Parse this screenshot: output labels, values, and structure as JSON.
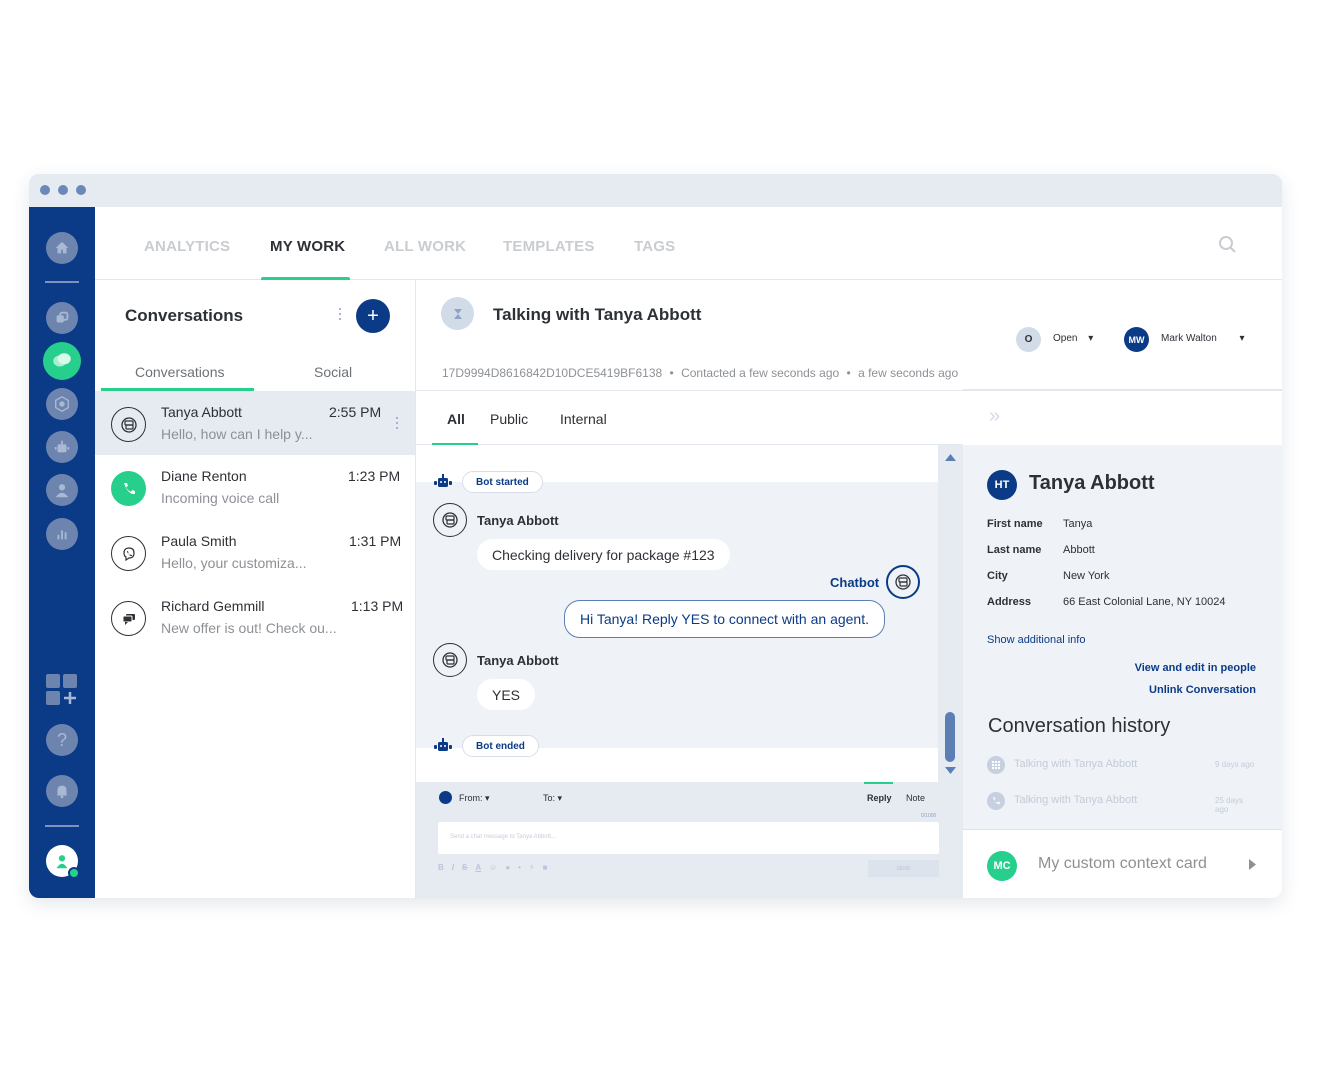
{
  "window": {
    "controls": [
      "dot",
      "dot",
      "dot"
    ]
  },
  "sidebar": {
    "items": [
      {
        "icon": "home-icon"
      },
      {
        "icon": "integrations-icon"
      },
      {
        "icon": "conversations-icon",
        "active": true
      },
      {
        "icon": "network-icon"
      },
      {
        "icon": "bot-icon"
      },
      {
        "icon": "people-icon"
      },
      {
        "icon": "analytics-icon"
      }
    ],
    "bottom": [
      {
        "icon": "add-apps-icon"
      },
      {
        "icon": "help-icon",
        "glyph": "?"
      },
      {
        "icon": "bell-icon"
      },
      {
        "icon": "user-avatar-icon"
      }
    ]
  },
  "topnav": {
    "tabs": [
      "ANALYTICS",
      "MY WORK",
      "ALL WORK",
      "TEMPLATES",
      "TAGS"
    ],
    "active": "MY WORK",
    "search_icon": "search-icon"
  },
  "conversations": {
    "title": "Conversations",
    "add_label": "+",
    "subtabs": [
      "Conversations",
      "Social"
    ],
    "active_subtab": "Conversations",
    "items": [
      {
        "name": "Tanya Abbott",
        "preview": "Hello, how can I help y...",
        "time": "2:55 PM",
        "channel": "chat-icon",
        "selected": true
      },
      {
        "name": "Diane Renton",
        "preview": "Incoming voice call",
        "time": "1:23 PM",
        "channel": "phone-icon"
      },
      {
        "name": "Paula Smith",
        "preview": "Hello, your customiza...",
        "time": "1:31 PM",
        "channel": "viber-icon"
      },
      {
        "name": "Richard Gemmill",
        "preview": "New offer is out! Check ou...",
        "time": "1:13 PM",
        "channel": "sms-icon"
      }
    ]
  },
  "chat": {
    "title": "Talking with Tanya Abbott",
    "meta_id": "17D9994D8616842D10DCE5419BF6138",
    "meta_contacted": "Contacted a few seconds ago",
    "meta_updated": "a few seconds ago",
    "separator": "•",
    "status": {
      "initial": "O",
      "label": "Open"
    },
    "assignee": {
      "initials": "MW",
      "name": "Mark Walton"
    },
    "tabs": [
      "All",
      "Public",
      "Internal"
    ],
    "active_tab": "All",
    "messages": [
      {
        "type": "event",
        "text": "Bot started"
      },
      {
        "type": "in",
        "sender": "Tanya Abbott",
        "text": "Checking delivery for package #123"
      },
      {
        "type": "out",
        "sender": "Chatbot",
        "text": "Hi Tanya! Reply YES to connect with an agent."
      },
      {
        "type": "in",
        "sender": "Tanya Abbott",
        "text": "YES"
      },
      {
        "type": "event",
        "text": "Bot ended"
      }
    ],
    "composer": {
      "from_label": "From:",
      "to_label": "To:",
      "modes": [
        "Reply",
        "Note"
      ],
      "active_mode": "Reply",
      "counter": "0/1000",
      "placeholder": "Send a chat message to Tanya Abbott...",
      "send_label": "SEND",
      "toolbar": [
        "B",
        "I",
        "S",
        "A"
      ]
    }
  },
  "contact": {
    "collapse_icon": "double-chevron-right-icon",
    "initials": "HT",
    "name": "Tanya Abbott",
    "fields": [
      {
        "label": "First name",
        "value": "Tanya"
      },
      {
        "label": "Last name",
        "value": "Abbott"
      },
      {
        "label": "City",
        "value": "New York"
      },
      {
        "label": "Address",
        "value": "66 East Colonial Lane, NY 10024"
      }
    ],
    "show_more": "Show additional info",
    "view_edit": "View and edit in people",
    "unlink": "Unlink Conversation",
    "history_title": "Conversation history",
    "history": [
      {
        "title": "Talking with Tanya Abbott",
        "when": "9 days ago",
        "icon": "keypad-icon"
      },
      {
        "title": "Talking with Tanya Abbott",
        "when": "25 days ago",
        "icon": "phone-icon"
      }
    ],
    "context_card": {
      "initials": "MC",
      "label": "My custom context card"
    }
  },
  "colors": {
    "brand": "#0b3b86",
    "accent": "#27cf8c"
  }
}
